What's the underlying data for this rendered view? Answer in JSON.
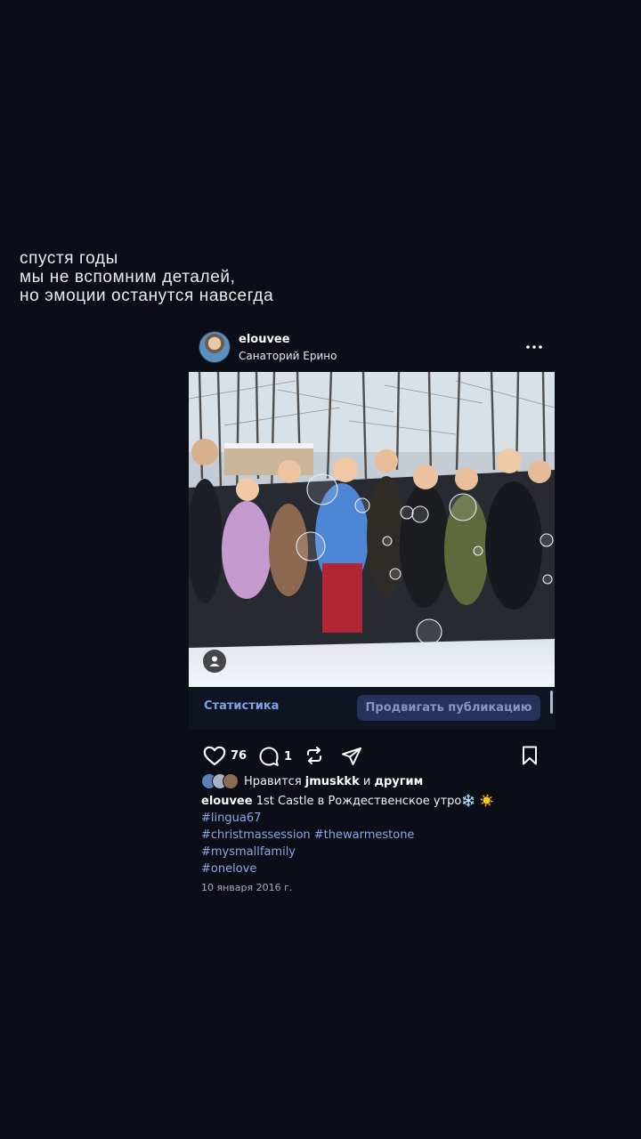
{
  "quote": {
    "lines": [
      "спустя годы",
      "мы не вспомним деталей,",
      "но эмоции останутся навсегда"
    ]
  },
  "post": {
    "username": "elouvee",
    "location": "Санаторий Ерино",
    "more_icon": "more-horizontal-icon",
    "photo_icon": "person-tag-icon",
    "stats_label": "Статистика",
    "promote_label": "Продвигать публикацию",
    "likes_count": "76",
    "comments_count": "1",
    "likes_prefix": "Нравится",
    "likes_user": "jmuskkk",
    "likes_and": "и",
    "likes_others": "другим",
    "caption_user": "elouvee",
    "caption_text": "1st Castle в Рождественское утро❄️ ☀️",
    "hashtags": [
      "#lingua67",
      "#christmassession #thewarmestone",
      "#mysmallfamily",
      "#onelove"
    ],
    "date": "10 января 2016 г."
  },
  "colors": {
    "background": "#0b0e16",
    "link": "#7ea4e6",
    "hashtag": "#8ea7e8",
    "promote_bg": "#27315e"
  }
}
